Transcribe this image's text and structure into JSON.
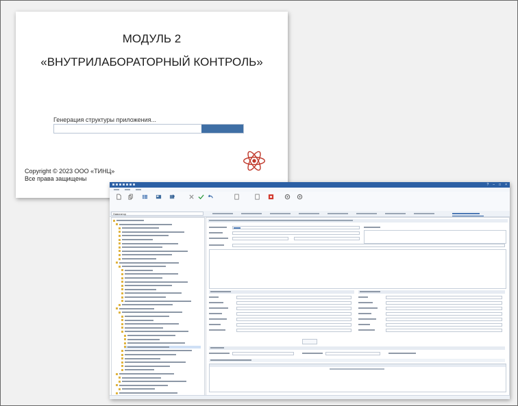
{
  "splash": {
    "title_line1": "МОДУЛЬ 2",
    "title_line2": "«ВНУТРИЛАБОРАТОРНЫЙ КОНТРОЛЬ»",
    "status_text": "Генерация структуры приложения...",
    "progress": 0.22,
    "copyright_line1": "Copyright © 2023 ООО «ТИНЦ»",
    "copyright_line2": "Все права защищены",
    "logo_icon": "atom-logo-icon",
    "accent_color": "#3f6fa5",
    "logo_color": "#c0392b"
  },
  "app": {
    "titlebar_color": "#2b5fa4",
    "navigator_label": "Навигатор"
  }
}
